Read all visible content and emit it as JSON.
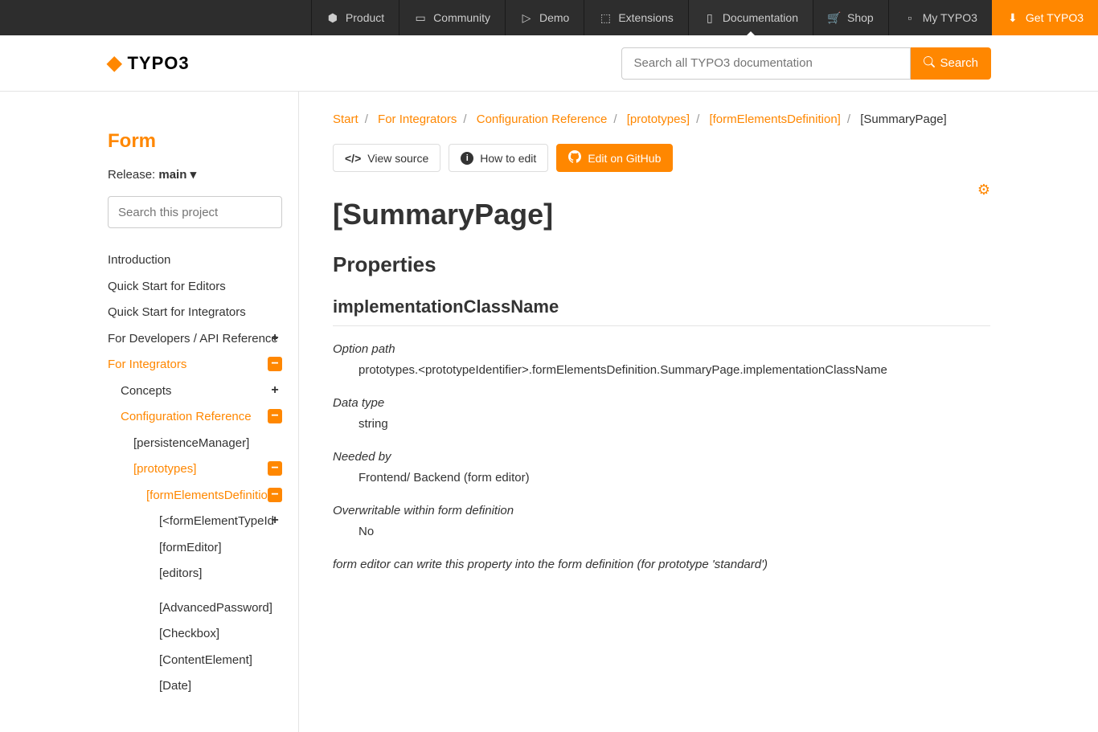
{
  "topnav": {
    "items": [
      {
        "label": "Product",
        "icon": "⬢"
      },
      {
        "label": "Community",
        "icon": "▭"
      },
      {
        "label": "Demo",
        "icon": "▷"
      },
      {
        "label": "Extensions",
        "icon": "⬚"
      },
      {
        "label": "Documentation",
        "icon": "▯",
        "active": true
      },
      {
        "label": "Shop",
        "icon": "🛒"
      },
      {
        "label": "My TYPO3",
        "icon": "▫"
      },
      {
        "label": "Get TYPO3",
        "icon": "⬇",
        "primary": true
      }
    ]
  },
  "logo_text": "TYPO3",
  "search": {
    "placeholder": "Search all TYPO3 documentation",
    "button": "Search"
  },
  "sidebar": {
    "title": "Form",
    "release_label": "Release:",
    "release_value": "main",
    "search_placeholder": "Search this project",
    "nav": {
      "introduction": "Introduction",
      "quick_editors": "Quick Start for Editors",
      "quick_integrators": "Quick Start for Integrators",
      "for_developers": "For Developers / API Reference",
      "for_integrators": "For Integrators",
      "concepts": "Concepts",
      "config_ref": "Configuration Reference",
      "persistence": "[persistenceManager]",
      "prototypes": "[prototypes]",
      "form_elements_def": "[formElementsDefinition]",
      "fet": "[<formElementTypeId",
      "form_editor": "[formEditor]",
      "editors": "[editors]",
      "advanced_pw": "[AdvancedPassword]",
      "checkbox": "[Checkbox]",
      "content_element": "[ContentElement]",
      "date": "[Date]"
    }
  },
  "breadcrumb": {
    "start": "Start",
    "integrators": "For Integrators",
    "config": "Configuration Reference",
    "proto": "[prototypes]",
    "fed": "[formElementsDefinition]",
    "current": "[SummaryPage]"
  },
  "actions": {
    "view_source": "View source",
    "how_to_edit": "How to edit",
    "edit_github": "Edit on GitHub"
  },
  "page": {
    "title": "[SummaryPage]",
    "h2": "Properties",
    "h3": "implementationClassName",
    "props": {
      "option_path_label": "Option path",
      "option_path_value": "prototypes.<prototypeIdentifier>.formElementsDefinition.SummaryPage.implementationClassName",
      "data_type_label": "Data type",
      "data_type_value": "string",
      "needed_by_label": "Needed by",
      "needed_by_value": "Frontend/ Backend (form editor)",
      "overwritable_label": "Overwritable within form definition",
      "overwritable_value": "No",
      "form_editor_can_label": "form editor can write this property into the form definition (for prototype 'standard')"
    }
  }
}
